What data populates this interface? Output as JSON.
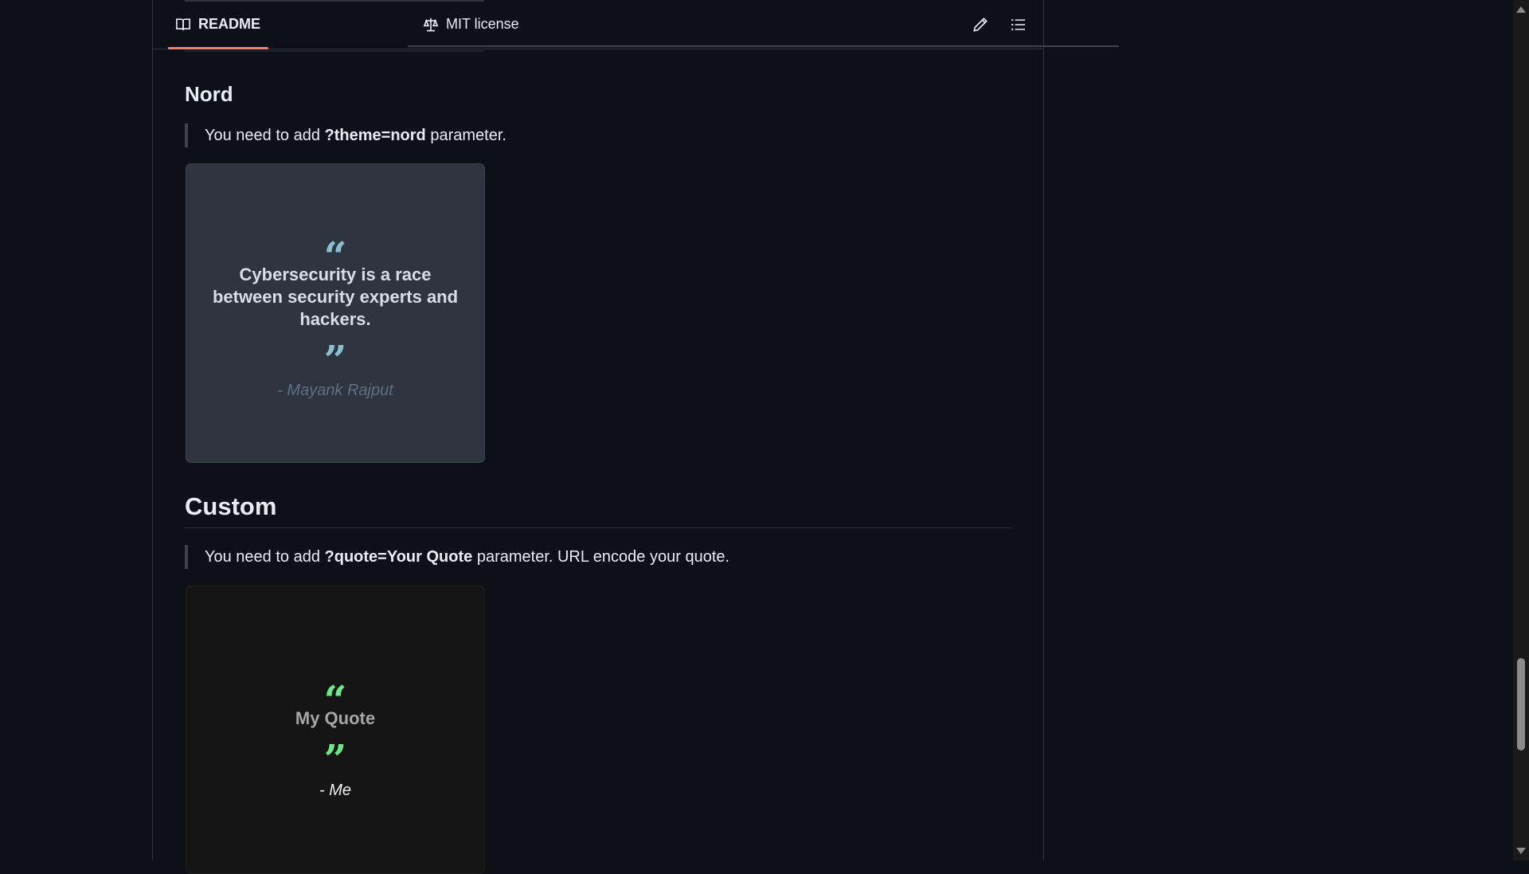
{
  "tabs": {
    "readme_label": "README",
    "license_label": "MIT license"
  },
  "sections": {
    "nord": {
      "heading": "Nord",
      "note_prefix": "You need to add ",
      "note_param": "?theme=nord",
      "note_suffix": " parameter.",
      "card": {
        "open_quote": "“",
        "close_quote": "”",
        "quote_line1": "Cybersecurity is a race",
        "quote_line2": "between security experts and",
        "quote_line3": "hackers.",
        "author": "- Mayank Rajput"
      }
    },
    "custom": {
      "heading": "Custom",
      "note_prefix": "You need to add ",
      "note_param": "?quote=Your Quote",
      "note_suffix": " parameter. URL encode your quote.",
      "card": {
        "open_quote": "“",
        "close_quote": "”",
        "quote_line1": "My Quote",
        "author": "- Me"
      }
    }
  },
  "icons": {
    "readme": "book-icon",
    "license": "scale-icon",
    "edit": "pencil-icon",
    "toc": "list-icon"
  },
  "colors": {
    "background": "#0d1117",
    "tab_active_underline": "#f78166",
    "nord_card_bg": "#2e3440",
    "nord_quote_mark": "#88c0d0",
    "nord_text": "#d8dee9",
    "nord_author": "#616e88",
    "custom_card_bg": "#151515",
    "custom_quote_mark": "#6ee787",
    "custom_text": "#a6a6a6",
    "custom_author": "#f0f0f0"
  }
}
